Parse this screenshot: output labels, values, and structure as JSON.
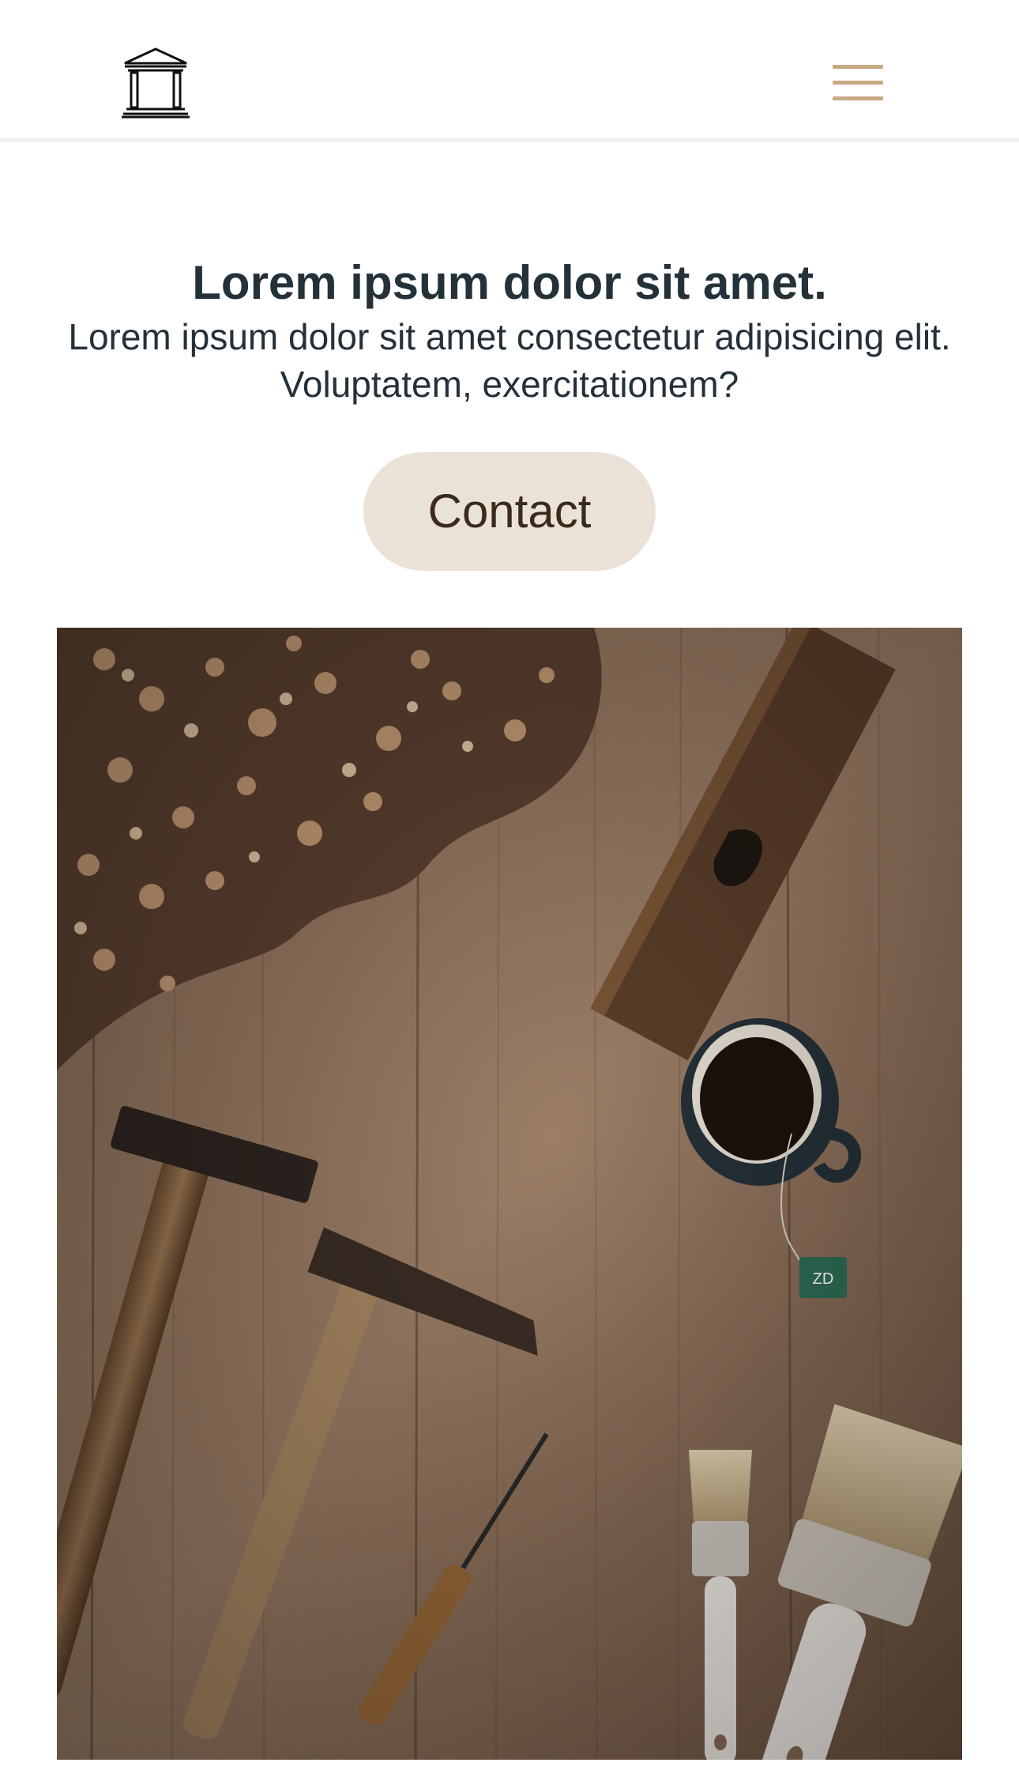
{
  "header": {
    "logo_icon": "temple-columns-icon",
    "menu_icon": "hamburger-menu-icon",
    "accent_color": "#c8aa84"
  },
  "hero": {
    "title": "Lorem ipsum dolor sit amet.",
    "subtitle": "Lorem ipsum dolor sit amet consectetur adipisicing elit. Voluptatem, exercitationem?",
    "contact_label": "Contact",
    "button_color": "#ebe2d7",
    "text_color": "#243139"
  },
  "photo": {
    "subject": "woodworking-tools-on-wooden-table",
    "tag_text": "ZD"
  }
}
